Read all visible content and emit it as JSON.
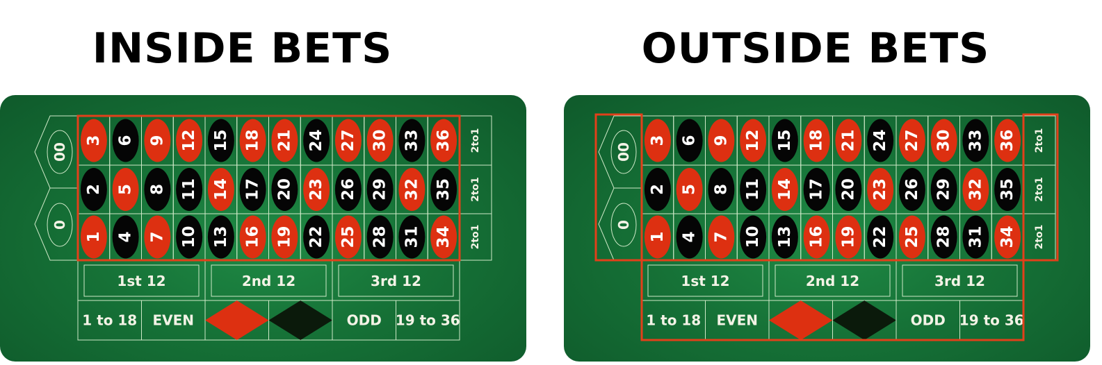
{
  "panels": [
    {
      "title": "INSIDE BETS",
      "highlight": "inside"
    },
    {
      "title": "OUTSIDE BETS",
      "highlight": "outside"
    }
  ],
  "table": {
    "zeros": [
      "00",
      "0"
    ],
    "rows": [
      [
        3,
        6,
        9,
        12,
        15,
        18,
        21,
        24,
        27,
        30,
        33,
        36
      ],
      [
        2,
        5,
        8,
        11,
        14,
        17,
        20,
        23,
        26,
        29,
        32,
        35
      ],
      [
        1,
        4,
        7,
        10,
        13,
        16,
        19,
        22,
        25,
        28,
        31,
        34
      ]
    ],
    "red_numbers": [
      1,
      3,
      5,
      7,
      9,
      12,
      14,
      16,
      18,
      19,
      21,
      23,
      25,
      27,
      30,
      32,
      34,
      36
    ],
    "column_bets": [
      "2 to 1",
      "2 to 1",
      "2 to 1"
    ],
    "dozens": [
      "1st 12",
      "2nd 12",
      "3rd 12"
    ],
    "even_money": [
      "1 to 18",
      "EVEN",
      "red-diamond",
      "black-diamond",
      "ODD",
      "19 to 36"
    ]
  },
  "colors": {
    "red": "#dd3011",
    "black": "#050505",
    "highlight": "#e2401a",
    "line": "#cfe9c8",
    "black_diamond": "#0b1a0b"
  }
}
